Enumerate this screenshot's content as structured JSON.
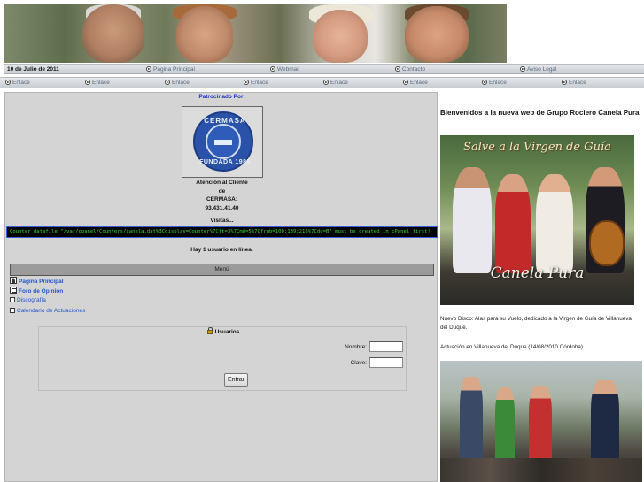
{
  "header": {
    "banner_alt": "Grupo Rociero Canela Pura"
  },
  "topbar": {
    "date": "10 de Julio de 2011",
    "items": [
      {
        "label": "Página Principal",
        "icon": "arrow-circle-icon"
      },
      {
        "label": "Webmail",
        "icon": "arrow-circle-icon"
      },
      {
        "label": "Contacto",
        "icon": "arrow-circle-icon"
      },
      {
        "label": "Aviso Legal",
        "icon": "arrow-circle-icon"
      }
    ]
  },
  "linkbar": {
    "items": [
      {
        "label": "Enlace"
      },
      {
        "label": "Enlace"
      },
      {
        "label": "Enlace"
      },
      {
        "label": "Enlace"
      },
      {
        "label": "Enlace"
      },
      {
        "label": "Enlace"
      },
      {
        "label": "Enlace"
      },
      {
        "label": "Enlace"
      }
    ]
  },
  "left": {
    "sponsor_title": "Patrocinado Por:",
    "logo": {
      "top": "CERMASA",
      "bottom": "FUNDADA 1985"
    },
    "attention": [
      "Atención al Cliente",
      "de",
      "CERMASA:",
      "93.431.41.40"
    ],
    "visits_label": "Visitas...",
    "counter_error": "Counter datafile \"/var/cpanel/Counters/canela.dat%3Cdisplay=Counter%7Cft=3%7Cmd=5%7Cfrgb=100;139;216%7Cdd=B\" must be created in cPanel first!",
    "online": "Hay 1 usuario en línea.",
    "menu": {
      "header": "Menú",
      "items": [
        {
          "label": "Página Principal",
          "icon": "home-icon"
        },
        {
          "label": "Foro de Opinión",
          "icon": "chat-icon"
        },
        {
          "label": "Discografía",
          "icon": "checkbox-icon"
        },
        {
          "label": "Calendario de Actuaciones",
          "icon": "checkbox-icon"
        }
      ]
    },
    "login": {
      "title": "Usuarios",
      "name_label": "Nombre:",
      "name_value": "",
      "password_label": "Clave:",
      "password_value": "",
      "submit": "Entrar"
    }
  },
  "right": {
    "welcome": "Bienvenidos a la nueva web de Grupo Rociero Canela Pura",
    "photo1": {
      "title": "Salve a la Virgen de Guía",
      "signature": "Canela Pura"
    },
    "news1": "Nuevo Disco: Alas para su Vuelo, dedicado a la Virgen de Guía de Villanueva del Duque.",
    "news2": "Actuación en Villanueva del Duque (14/08/2010 Córdoba)"
  },
  "colors": {
    "link": "#2255cc",
    "sponsor_title": "#2233cc",
    "counter_text": "#3cd23c",
    "panel_bg": "#d4d4d4"
  }
}
